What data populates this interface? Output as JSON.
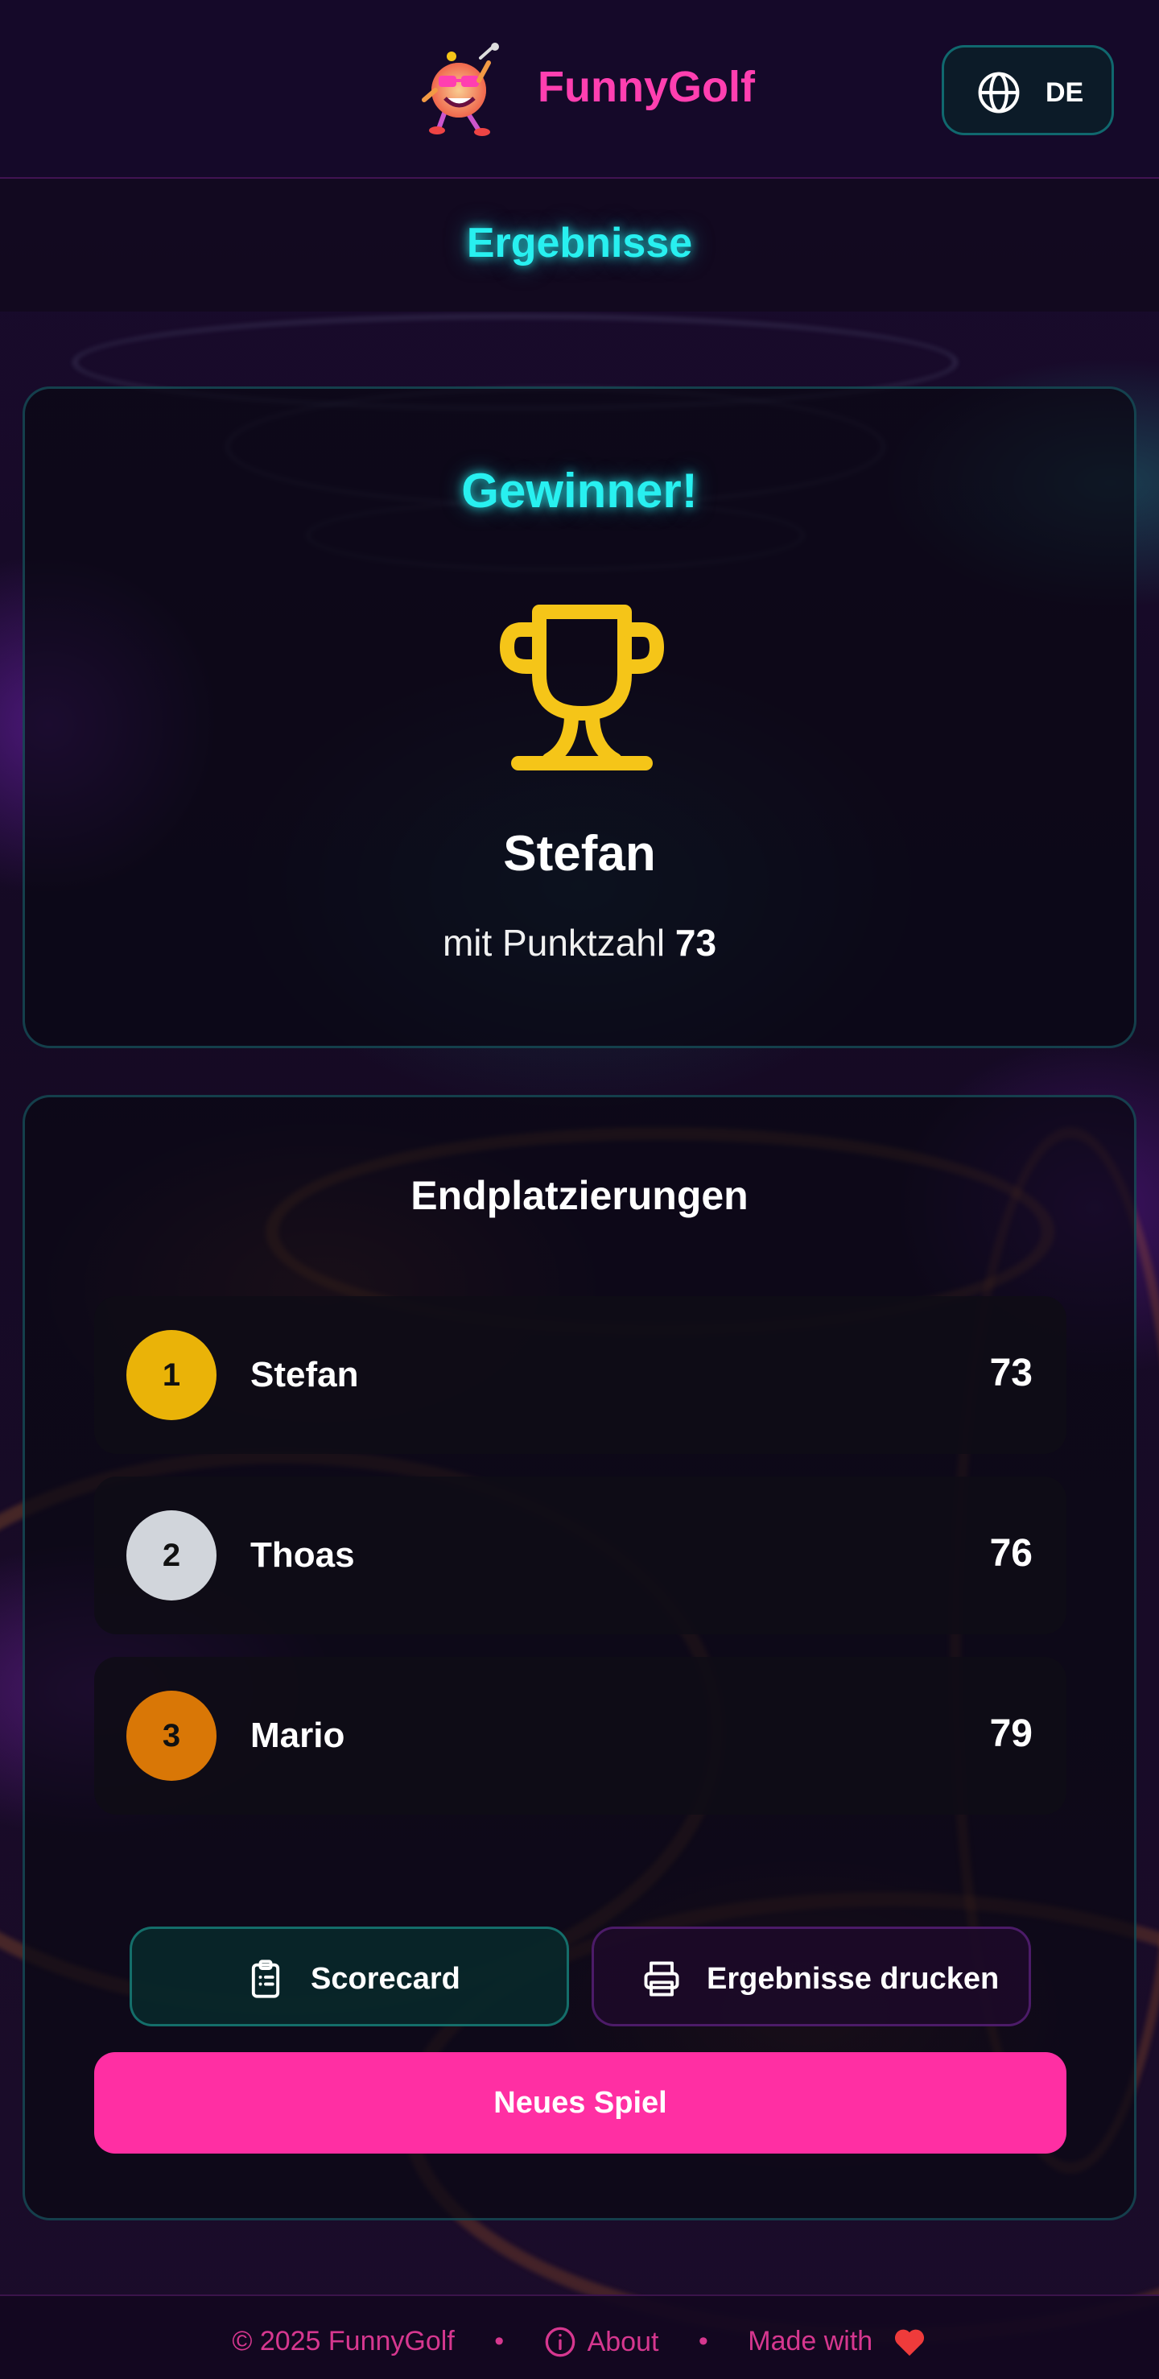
{
  "header": {
    "brand": "FunnyGolf",
    "language": "DE"
  },
  "page": {
    "title": "Ergebnisse"
  },
  "winner": {
    "heading": "Gewinner!",
    "name": "Stefan",
    "score_prefix": "mit Punktzahl",
    "score": "73"
  },
  "rankings": {
    "heading": "Endplatzierungen",
    "rows": [
      {
        "rank": "1",
        "name": "Stefan",
        "score": "73",
        "color": "#eab308"
      },
      {
        "rank": "2",
        "name": "Thoas",
        "score": "76",
        "color": "#d1d5db"
      },
      {
        "rank": "3",
        "name": "Mario",
        "score": "79",
        "color": "#d97706"
      }
    ]
  },
  "actions": {
    "scorecard_label": "Scorecard",
    "print_label": "Ergebnisse drucken",
    "new_game_label": "Neues Spiel"
  },
  "footer": {
    "copyright": "© 2025 FunnyGolf",
    "separator": "•",
    "about": "About",
    "made_with": "Made with"
  },
  "colors": {
    "accent_cyan": "#28f0f0",
    "brand_pink": "#ff3fb0",
    "button_pink": "#ff2fa3",
    "trophy_gold": "#f5c518"
  },
  "icons": {
    "language": "globe-icon",
    "winner": "trophy-icon",
    "scorecard": "clipboard-list-icon",
    "print": "printer-icon",
    "about": "info-icon",
    "made_with": "heart-icon"
  }
}
